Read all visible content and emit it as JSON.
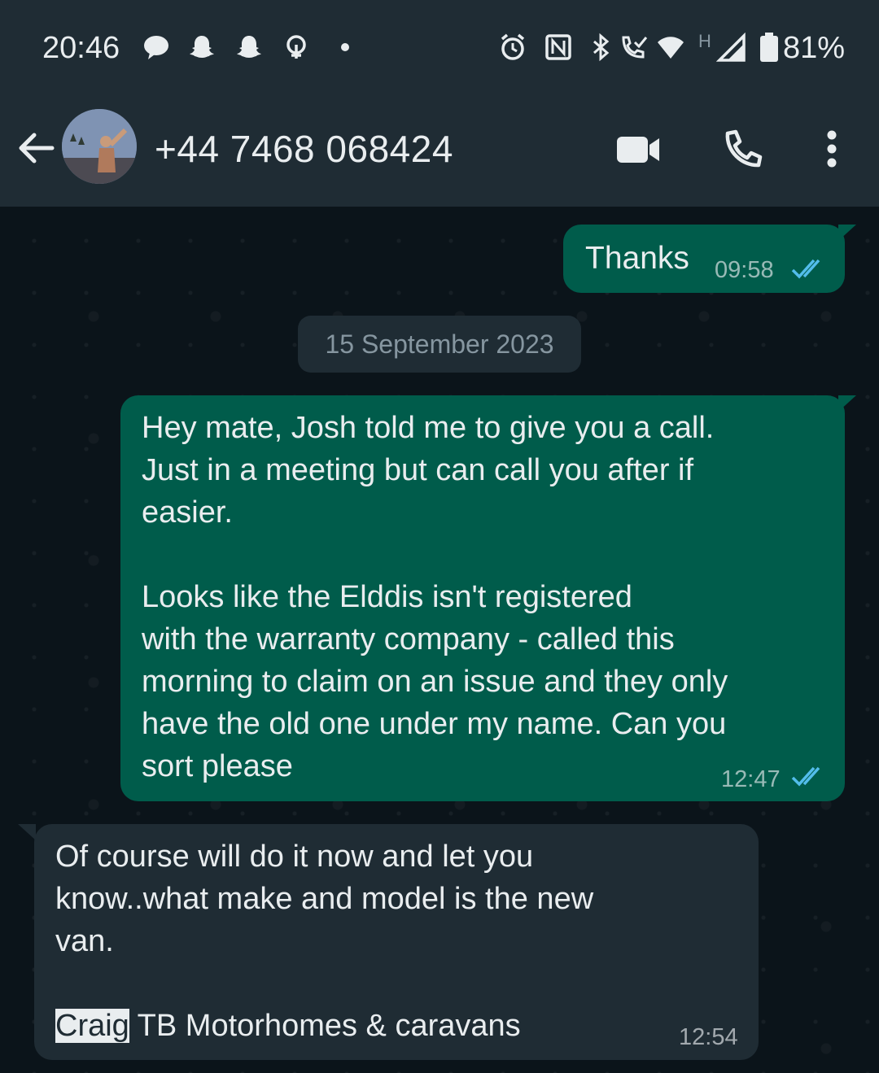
{
  "status_bar": {
    "time": "20:46",
    "battery": "81%",
    "network_type": "H"
  },
  "header": {
    "contact": "+44 7468 068424"
  },
  "date_separator": "15 September 2023",
  "messages": [
    {
      "direction": "outgoing",
      "text": "Thanks",
      "time": "09:58",
      "status": "read"
    },
    {
      "direction": "outgoing",
      "text": "Hey mate, Josh told me to give you a call.\nJust in a meeting but can call you after if\neasier.\n\nLooks like the Elddis isn't registered\nwith the warranty company - called this\nmorning to claim on an issue and they only\nhave the old one under my name. Can you\nsort please",
      "time": "12:47",
      "status": "read"
    },
    {
      "direction": "incoming",
      "text": "Of course will do it now and let you\nknow..what make and model is the new\nvan.\n",
      "signature_highlight": "Craig",
      "signature_rest": " TB Motorhomes & caravans",
      "time": "12:54"
    }
  ],
  "colors": {
    "outgoing_bubble": "#005c4b",
    "incoming_bubble": "#1f2c34",
    "read_ticks": "#53bdeb"
  }
}
